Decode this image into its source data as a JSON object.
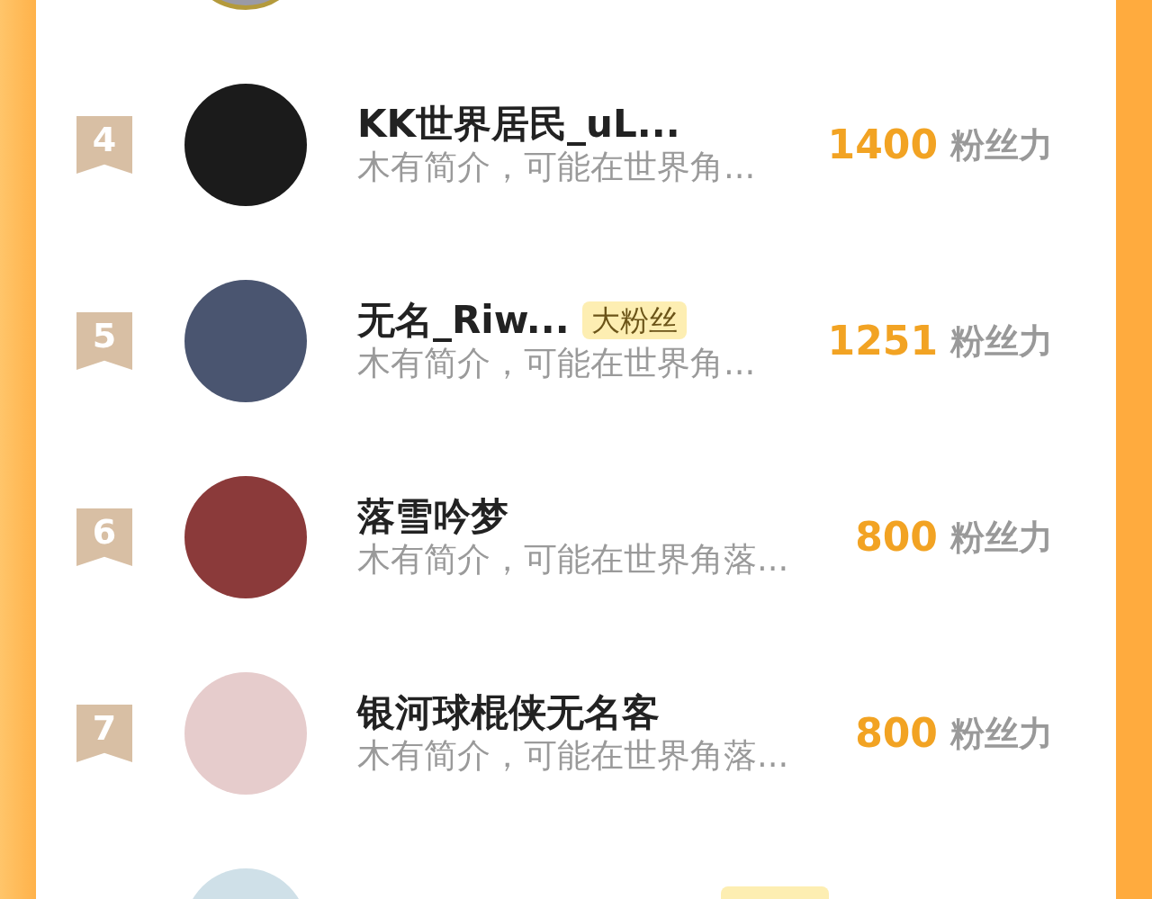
{
  "entries": [
    {
      "rank": "4",
      "name": "KK世界居民_uL...",
      "bio": "木有简介，可能在世界角...",
      "score": "1400",
      "unit": "粉丝力"
    },
    {
      "rank": "5",
      "name": "无名_Riw...",
      "badge": "大粉丝",
      "bio": "木有简介，可能在世界角...",
      "score": "1251",
      "unit": "粉丝力"
    },
    {
      "rank": "6",
      "name": "落雪吟梦",
      "bio": "木有简介，可能在世界角落...",
      "score": "800",
      "unit": "粉丝力"
    },
    {
      "rank": "7",
      "name": "银河球棍侠无名客",
      "bio": "木有简介，可能在世界角落...",
      "score": "800",
      "unit": "粉丝力"
    }
  ],
  "cut_off_entry": {
    "has_badge": true
  }
}
